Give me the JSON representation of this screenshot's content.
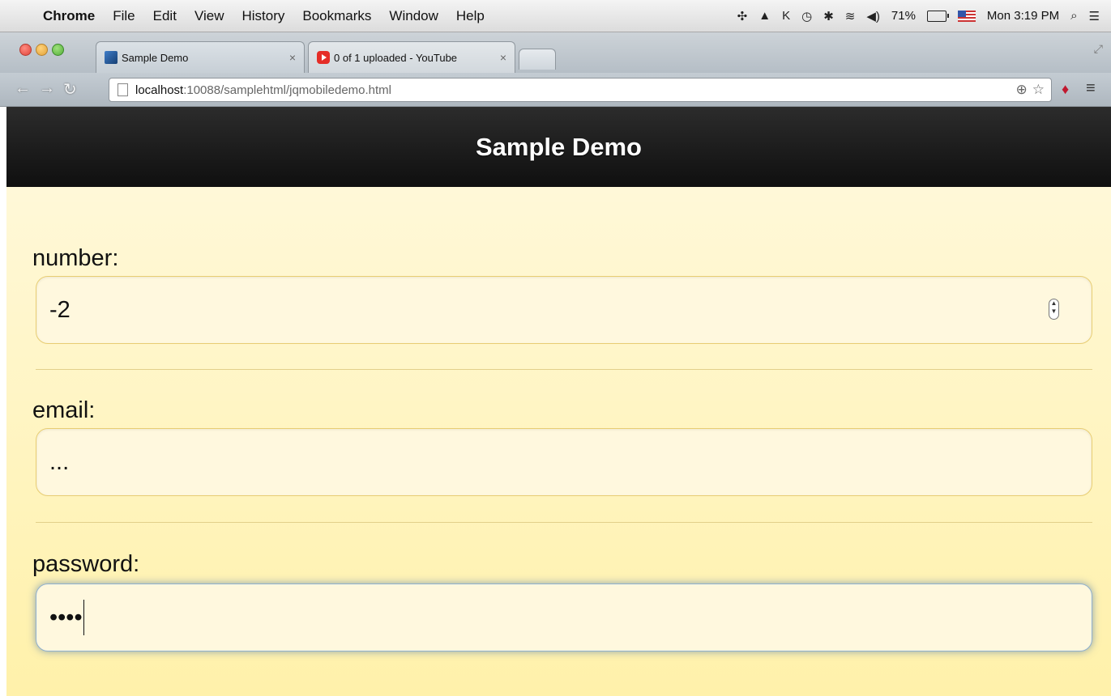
{
  "menubar": {
    "app": "Chrome",
    "items": [
      "File",
      "Edit",
      "View",
      "History",
      "Bookmarks",
      "Window",
      "Help"
    ],
    "battery": "71%",
    "clock": "Mon 3:19 PM"
  },
  "tabs": [
    {
      "title": "Sample Demo",
      "favicon": "page-favicon"
    },
    {
      "title": "0 of 1 uploaded - YouTube",
      "favicon": "youtube-favicon"
    }
  ],
  "address_bar": {
    "host": "localhost",
    "path": ":10088/samplehtml/jqmobiledemo.html"
  },
  "page": {
    "title": "Sample Demo",
    "fields": [
      {
        "label": "number:",
        "value": "-2",
        "type": "number"
      },
      {
        "label": "email:",
        "value": "...",
        "type": "email"
      },
      {
        "label": "password:",
        "value": "••••",
        "type": "password",
        "focused": true
      }
    ]
  },
  "colors": {
    "header_bg": "#1a1a1a",
    "content_bg": "#fff4c0",
    "input_border": "#e8cd72",
    "focus_glow": "#4f78aa"
  }
}
